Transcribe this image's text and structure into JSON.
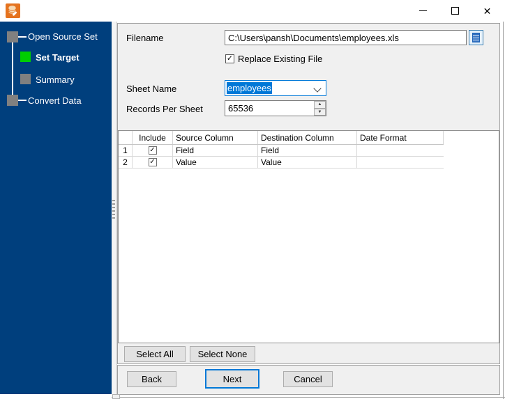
{
  "titlebar": {
    "app_icon_name": "database-edit-icon"
  },
  "icons": {
    "close_glyph": "✕",
    "check_glyph": "✓",
    "spin_up_glyph": "▲",
    "spin_down_glyph": "▼"
  },
  "sidebar": {
    "steps": [
      {
        "label": "Open Source Set",
        "state": "done"
      },
      {
        "label": "Set Target",
        "state": "active"
      },
      {
        "label": "Summary",
        "state": "pending"
      },
      {
        "label": "Convert Data",
        "state": "pending"
      }
    ]
  },
  "form": {
    "filename_label": "Filename",
    "filename_value": "C:\\Users\\pansh\\Documents\\employees.xls",
    "replace_label": "Replace Existing File",
    "replace_checked": true,
    "sheet_name_label": "Sheet Name",
    "sheet_name_value": "employees",
    "records_label": "Records Per Sheet",
    "records_value": "65536"
  },
  "table": {
    "headers": [
      "",
      "Include",
      "Source Column",
      "Destination Column",
      "Date Format"
    ],
    "rows": [
      {
        "num": "1",
        "include": true,
        "source": "Field",
        "destination": "Field",
        "date_format": ""
      },
      {
        "num": "2",
        "include": true,
        "source": "Value",
        "destination": "Value",
        "date_format": ""
      }
    ]
  },
  "buttons": {
    "select_all": "Select All",
    "select_none": "Select None",
    "back": "Back",
    "next": "Next",
    "cancel": "Cancel"
  },
  "colors": {
    "sidebar_background": "#003F7D",
    "step_active": "#00CE00",
    "step_inactive": "#808080",
    "focus_accent": "#0078D7",
    "app_icon_orange": "#E5731F"
  }
}
